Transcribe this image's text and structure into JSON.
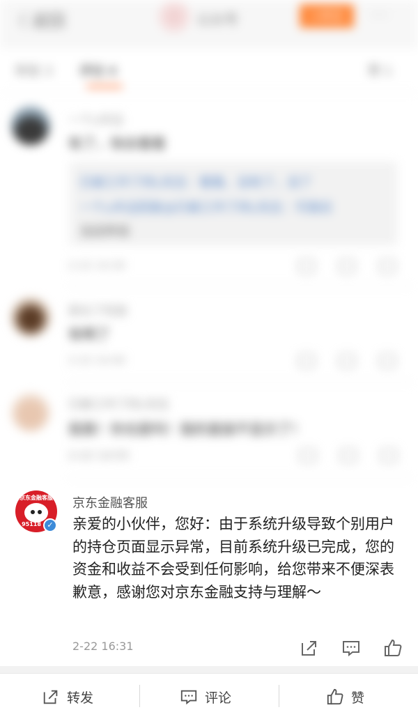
{
  "header": {
    "back_label": "〈 返回",
    "blogger_name": "公众号",
    "follow_label": "+关注",
    "more_label": "···"
  },
  "tabs": {
    "repost": "转发 3",
    "comment": "评论 4",
    "like": "赞 1"
  },
  "comments": [
    {
      "user": "一个u半边",
      "text": "有了，快去看看",
      "quote_line1": "已被工作了的L先生：看看，没有了，没了",
      "quote_line2": "一个u半边回复@已被工作了的L先生：可是应",
      "quote_line3": "当这样说",
      "time": "2-22 14:30"
    },
    {
      "user": "家长了吃饭",
      "text": "有啊了",
      "time": "2-22 14:40"
    },
    {
      "user": "已被工作了的L先生",
      "text": "我靠！你也是吗！我的直接不显示了！",
      "time": "2-22 14:55"
    },
    {
      "user": "京东金融客服",
      "text": "亲爱的小伙伴，您好：由于系统升级导致个别用户的持仓页面显示异常，目前系统升级已完成，您的资金和收益不会受到任何影响，给您带来不便深表歉意，感谢您对京东金融支持与理解～",
      "time": "2-22 16:31",
      "avatar_logo_text": "京东金融客服",
      "avatar_logo_number": "95118",
      "verified_icon": "verified-check-icon"
    }
  ],
  "bottom_bar": {
    "repost_label": "转发",
    "comment_label": "评论",
    "like_label": "赞"
  },
  "colors": {
    "accent_orange": "#ff7a3d",
    "brand_red": "#d81e28",
    "verified_blue": "#3d8bd9"
  }
}
